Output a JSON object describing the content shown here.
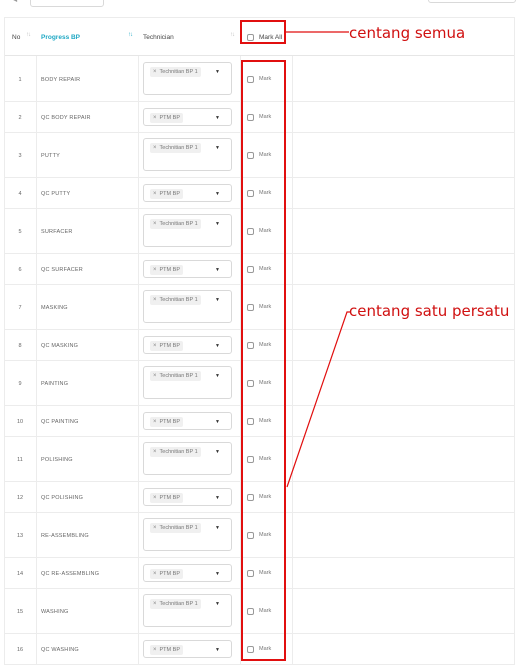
{
  "header": {
    "no": "No",
    "progress": "Progress BP",
    "technician": "Technician",
    "mark_all": "Mark All"
  },
  "rows": [
    {
      "no": "1",
      "progress": "BODY REPAIR",
      "technician": "Technitian BP 1"
    },
    {
      "no": "2",
      "progress": "QC BODY REPAIR",
      "technician": "PTM BP"
    },
    {
      "no": "3",
      "progress": "PUTTY",
      "technician": "Technitian BP 1"
    },
    {
      "no": "4",
      "progress": "QC PUTTY",
      "technician": "PTM BP"
    },
    {
      "no": "5",
      "progress": "SURFACER",
      "technician": "Technitian BP 1"
    },
    {
      "no": "6",
      "progress": "QC SURFACER",
      "technician": "PTM BP"
    },
    {
      "no": "7",
      "progress": "MASKING",
      "technician": "Technitian BP 1"
    },
    {
      "no": "8",
      "progress": "QC MASKING",
      "technician": "PTM BP"
    },
    {
      "no": "9",
      "progress": "PAINTING",
      "technician": "Technitian BP 1"
    },
    {
      "no": "10",
      "progress": "QC PAINTING",
      "technician": "PTM BP"
    },
    {
      "no": "11",
      "progress": "POLISHING",
      "technician": "Technitian BP 1"
    },
    {
      "no": "12",
      "progress": "QC POLISHING",
      "technician": "PTM BP"
    },
    {
      "no": "13",
      "progress": "RE-ASSEMBLING",
      "technician": "Technitian BP 1"
    },
    {
      "no": "14",
      "progress": "QC RE-ASSEMBLING",
      "technician": "PTM BP"
    },
    {
      "no": "15",
      "progress": "WASHING",
      "technician": "Technitian BP 1"
    },
    {
      "no": "16",
      "progress": "QC WASHING",
      "technician": "PTM BP"
    }
  ],
  "row_mark_label": "Mark",
  "annotations": {
    "all": "centang semua",
    "each": "centang satu persatu"
  },
  "colors": {
    "accent": "#1fa8c4",
    "annotation": "#e10f0f"
  }
}
